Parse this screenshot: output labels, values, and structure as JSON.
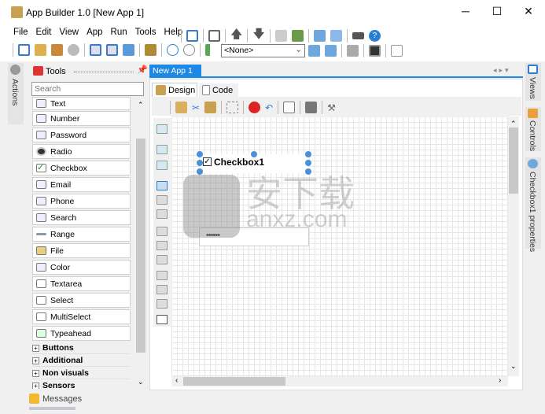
{
  "window": {
    "title": "App Builder 1.0 [New App 1]",
    "minimize": "─",
    "maximize": "☐",
    "close": "✕"
  },
  "menu": [
    "File",
    "Edit",
    "View",
    "App",
    "Run",
    "Tools",
    "Help"
  ],
  "toolbar": {
    "target_select": "<None>"
  },
  "left_strip": {
    "actions": "Actions"
  },
  "tools": {
    "title": "Tools",
    "search_placeholder": "Search",
    "items": [
      "Text",
      "Number",
      "Password",
      "Radio",
      "Checkbox",
      "Email",
      "Phone",
      "Search",
      "Range",
      "File",
      "Color",
      "Textarea",
      "Select",
      "MultiSelect",
      "Typeahead"
    ],
    "groups": [
      "Buttons",
      "Additional",
      "Non visuals",
      "Sensors"
    ]
  },
  "messages": "Messages",
  "doc_tab": {
    "label": "New App 1",
    "close": "✕"
  },
  "editor_tabs": [
    "Design",
    "Code"
  ],
  "canvas": {
    "checkbox_label": "Checkbox1",
    "password_value": "••••••"
  },
  "right_strip": [
    "Views",
    "Controls",
    "Checkbox1 properties"
  ],
  "watermark": "安下载 anxz.com",
  "colors": {
    "accent": "#1e88e5",
    "handle": "#4a90d9"
  }
}
